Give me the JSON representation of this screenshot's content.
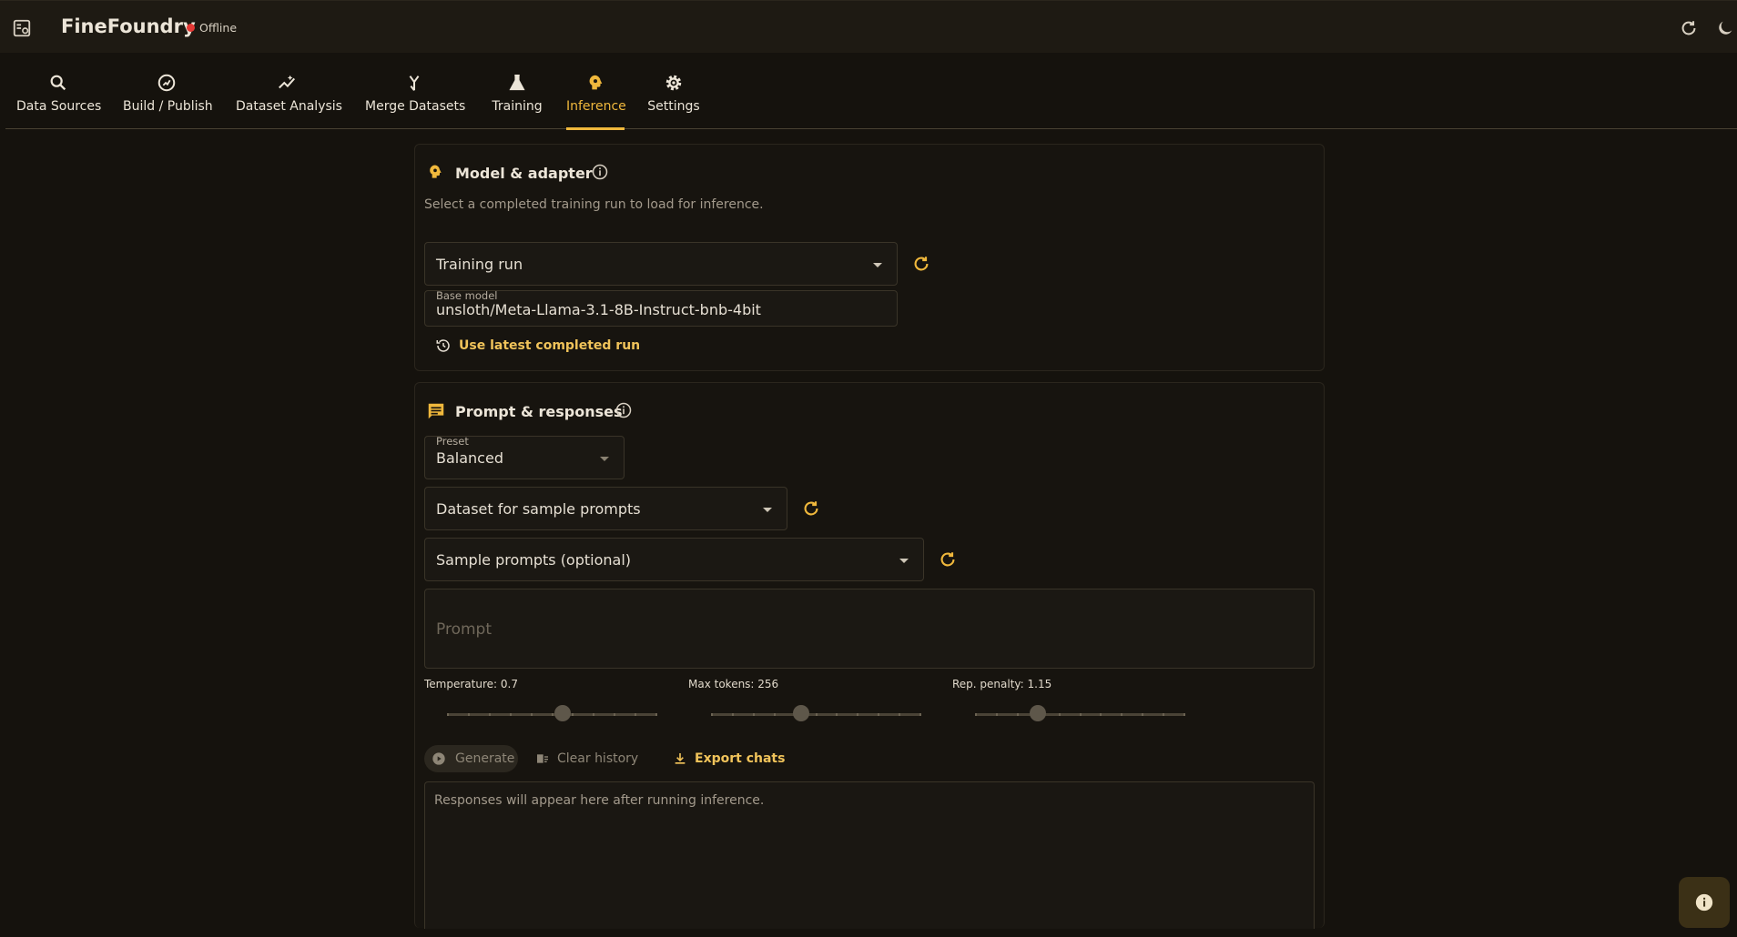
{
  "app": {
    "title": "FineFoundry",
    "status": "Offline",
    "status_color": "#e53935",
    "accent": "#f0b83c"
  },
  "tabs": [
    {
      "label": "Data Sources",
      "icon": "search-icon"
    },
    {
      "label": "Build / Publish",
      "icon": "publish-icon"
    },
    {
      "label": "Dataset Analysis",
      "icon": "insights-icon"
    },
    {
      "label": "Merge Datasets",
      "icon": "merge-icon"
    },
    {
      "label": "Training",
      "icon": "flask-icon"
    },
    {
      "label": "Inference",
      "icon": "psychology-icon",
      "active": true
    },
    {
      "label": "Settings",
      "icon": "gear-icon"
    }
  ],
  "model_card": {
    "title": "Model & adapter",
    "subtitle": "Select a completed training run to load for inference.",
    "training_run_label": "Training run",
    "base_model_label": "Base model",
    "base_model_value": "unsloth/Meta-Llama-3.1-8B-Instruct-bnb-4bit",
    "use_latest_label": "Use latest completed run"
  },
  "prompt_card": {
    "title": "Prompt & responses",
    "preset_label": "Preset",
    "preset_value": "Balanced",
    "dataset_label": "Dataset for sample prompts",
    "sample_prompts_label": "Sample prompts (optional)",
    "prompt_placeholder": "Prompt",
    "sliders": {
      "temperature": {
        "label": "Temperature: 0.7",
        "fraction": 0.55,
        "ticks": 11
      },
      "max_tokens": {
        "label": "Max tokens: 256",
        "fraction": 0.43,
        "ticks": 11
      },
      "rep_penalty": {
        "label": "Rep. penalty: 1.15",
        "fraction": 0.3,
        "ticks": 11
      }
    },
    "generate_label": "Generate",
    "clear_history_label": "Clear history",
    "export_chats_label": "Export chats",
    "responses_placeholder": "Responses will appear here after running inference."
  }
}
